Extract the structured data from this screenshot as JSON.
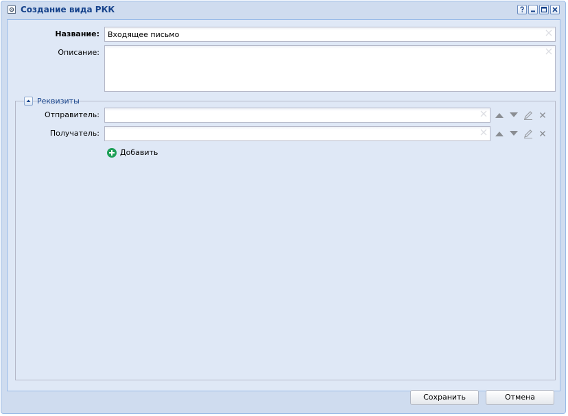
{
  "window": {
    "title": "Создание вида РКК",
    "tools": [
      "help-icon",
      "minimize-icon",
      "maximize-icon",
      "close-icon"
    ]
  },
  "form": {
    "name_label": "Название:",
    "name_value": "Входящее письмо",
    "description_label": "Описание:",
    "description_value": ""
  },
  "requisites": {
    "legend": "Реквизиты",
    "rows": [
      {
        "label": "Отправитель:",
        "value": ""
      },
      {
        "label": "Получатель:",
        "value": ""
      }
    ],
    "add_label": "Добавить"
  },
  "buttons": {
    "save": "Сохранить",
    "cancel": "Отмена"
  },
  "colors": {
    "window_bg": "#cfdcef",
    "panel_bg": "#dfe8f6",
    "title_text": "#15428b",
    "add_icon": "#1d9f57"
  }
}
